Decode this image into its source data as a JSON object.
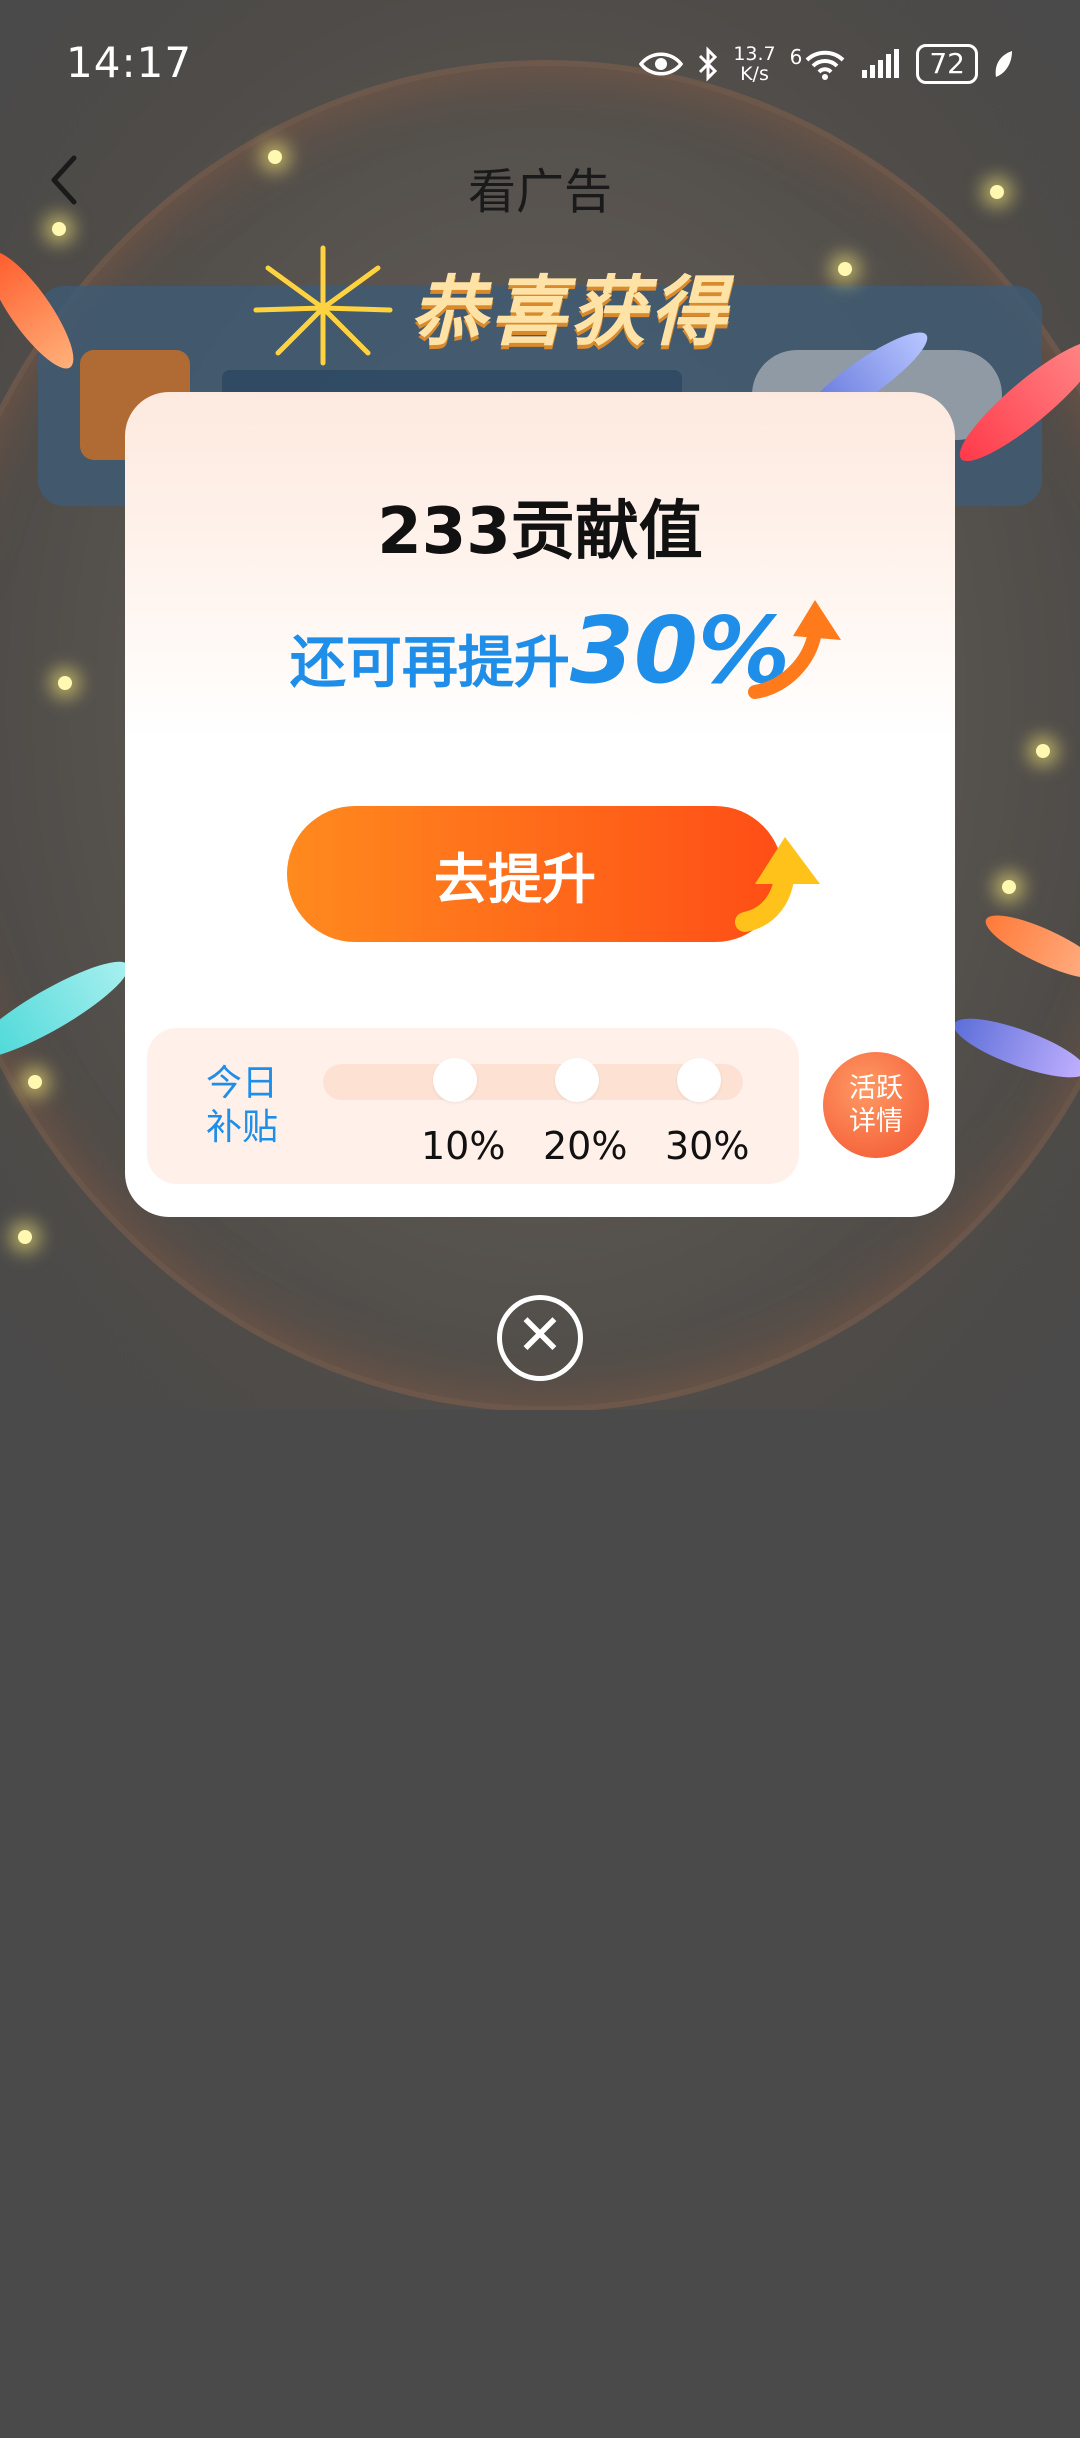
{
  "status_bar": {
    "time": "14:17",
    "net_speed_value": "13.7",
    "net_speed_unit": "K/s",
    "network_type": "6",
    "battery": "72"
  },
  "nav": {
    "back_icon": "chevron-left-icon",
    "title": "看广告"
  },
  "header": {
    "congrats_text": "恭喜获得"
  },
  "reward_card": {
    "amount": "233贡献值",
    "boost_label": "还可再提升",
    "boost_value": "30%",
    "action_button": "去提升",
    "subsidy": {
      "label_line1": "今日",
      "label_line2": "补贴",
      "progress_fraction": 0,
      "ticks": [
        "10%",
        "20%",
        "30%"
      ]
    },
    "active_badge_line1": "活跃",
    "active_badge_line2": "详情"
  },
  "colors": {
    "accent_blue": "#1f8ee8",
    "button_orange": "#ff6a1a",
    "dim_background": "#4a4a4a"
  }
}
